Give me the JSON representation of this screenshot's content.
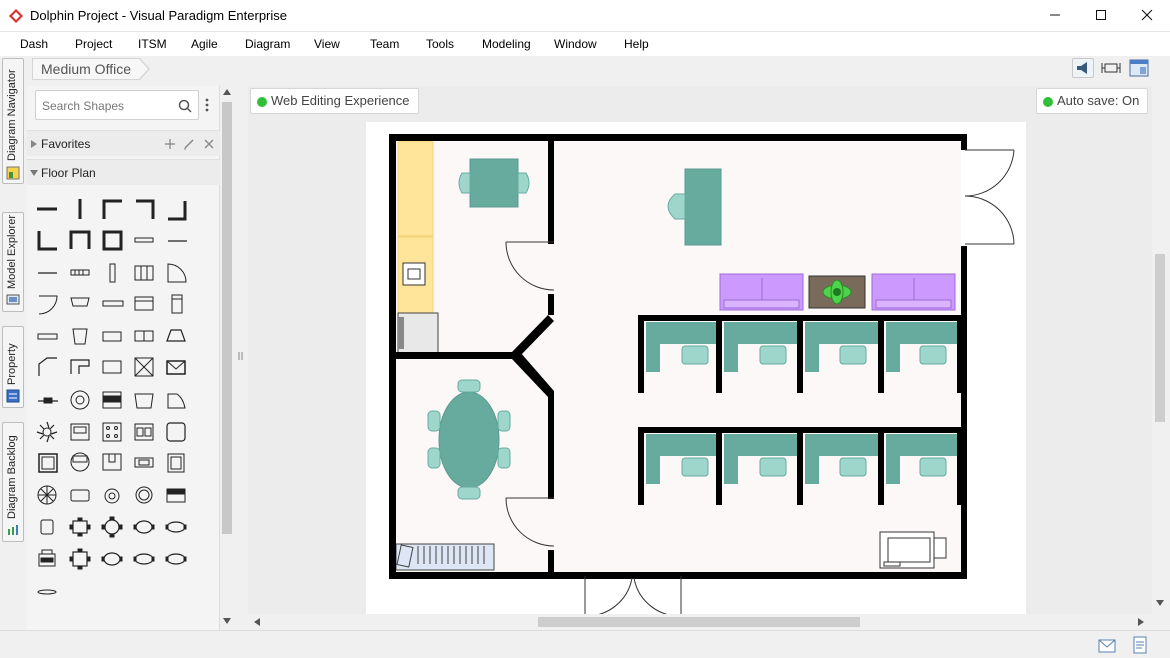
{
  "window": {
    "title": "Dolphin Project - Visual Paradigm Enterprise"
  },
  "menu": [
    "Dash",
    "Project",
    "ITSM",
    "Agile",
    "Diagram",
    "View",
    "Team",
    "Tools",
    "Modeling",
    "Window",
    "Help"
  ],
  "side_tabs": [
    "Diagram Navigator",
    "Model Explorer",
    "Property",
    "Diagram Backlog"
  ],
  "breadcrumb": "Medium Office",
  "shapes_panel": {
    "search_placeholder": "Search Shapes",
    "sections": [
      "Favorites",
      "Floor Plan"
    ]
  },
  "canvas": {
    "mode_label": "Web Editing Experience",
    "autosave_label": "Auto save: On"
  },
  "colors": {
    "accent_green": "#2fbf3a",
    "furniture_teal": "#67ab9f",
    "sofa_purple": "#cc99ff",
    "counter_yellow": "#ffe599",
    "wall": "#000000",
    "floor": "#fdf8f8"
  }
}
